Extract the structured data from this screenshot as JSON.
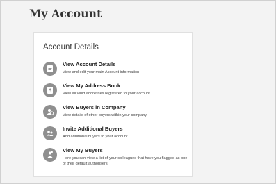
{
  "page": {
    "title": "My Account"
  },
  "card": {
    "title": "Account Details",
    "items": [
      {
        "icon": "account-details-icon",
        "title": "View Account Details",
        "description": "View and edit your main Account information"
      },
      {
        "icon": "address-book-icon",
        "title": "View My Address Book",
        "description": "View all valid addresses registered to your account"
      },
      {
        "icon": "buyers-in-company-icon",
        "title": "View Buyers in Company",
        "description": "View details of other buyers within your company"
      },
      {
        "icon": "invite-buyers-icon",
        "title": "Invite Additional Buyers",
        "description": "Add additional buyers to your account"
      },
      {
        "icon": "my-buyers-icon",
        "title": "View My Buyers",
        "description": "Here you can view a list of your colleagues that have you flagged as one of their default authorisers"
      }
    ]
  }
}
